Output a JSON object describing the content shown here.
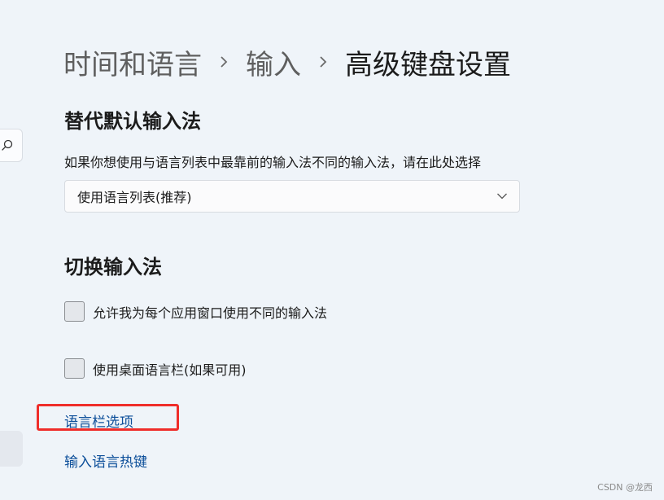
{
  "breadcrumb": {
    "items": [
      "时间和语言",
      "输入",
      "高级键盘设置"
    ]
  },
  "section_override": {
    "title": "替代默认输入法",
    "description": "如果你想使用与语言列表中最靠前的输入法不同的输入法，请在此处选择",
    "dropdown_value": "使用语言列表(推荐)"
  },
  "section_switch": {
    "title": "切换输入法",
    "checkbox_per_app": "允许我为每个应用窗口使用不同的输入法",
    "checkbox_per_app_checked": false,
    "checkbox_desktop_bar": "使用桌面语言栏(如果可用)",
    "checkbox_desktop_bar_checked": false
  },
  "links": {
    "language_bar_options": "语言栏选项",
    "input_hotkeys": "输入语言热键"
  },
  "icons": {
    "search": "search-icon",
    "breadcrumb_separator": "chevron-right-icon",
    "dropdown": "chevron-down-icon"
  },
  "colors": {
    "background": "#eff4f9",
    "link": "#0d4f9a",
    "highlight": "#ef2d2a"
  },
  "watermark": "CSDN @龙西"
}
